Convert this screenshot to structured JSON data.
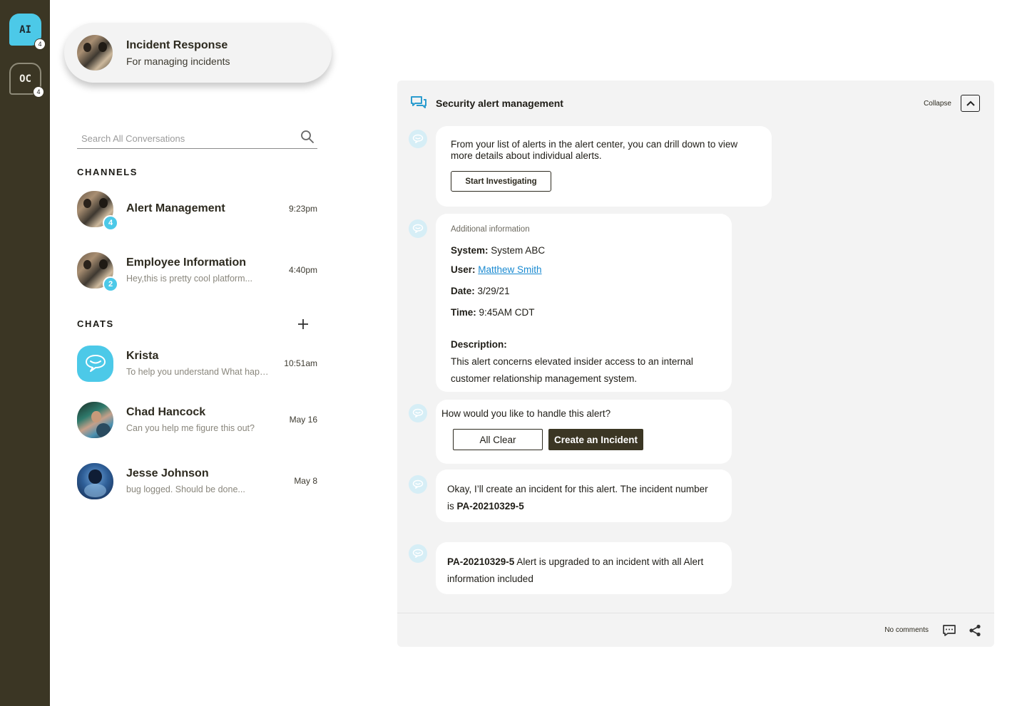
{
  "rail": {
    "workspaces": [
      {
        "label": "AI",
        "badge": "4"
      },
      {
        "label": "OC",
        "badge": "4"
      }
    ]
  },
  "team": {
    "name": "Incident Response",
    "subtitle": "For managing incidents"
  },
  "search": {
    "placeholder": "Search All Conversations"
  },
  "channels": {
    "title": "CHANNELS",
    "items": [
      {
        "name": "Alert Management",
        "preview": "",
        "time": "9:23pm",
        "badge": "4"
      },
      {
        "name": "Employee Information",
        "preview": "Hey,this is pretty cool platform...",
        "time": "4:40pm",
        "badge": "2"
      }
    ]
  },
  "chats": {
    "title": "CHATS",
    "items": [
      {
        "name": "Krista",
        "preview": "To help you understand What happe..",
        "time": "10:51am"
      },
      {
        "name": "Chad Hancock",
        "preview": "Can you help me figure this out?",
        "time": "May 16"
      },
      {
        "name": "Jesse Johnson",
        "preview": "bug logged. Should be done...",
        "time": "May 8"
      }
    ]
  },
  "panel": {
    "title": "Security alert management",
    "collapse_label": "Collapse",
    "messages": {
      "intro": "From your list of alerts in the alert center, you can drill down to view more details about individual alerts.",
      "start_button": "Start Investigating",
      "info_title": "Additional information",
      "system_label": "System:",
      "system_value": "System ABC",
      "user_label": "User:",
      "user_value": "Matthew Smith",
      "date_label": "Date:",
      "date_value": "3/29/21",
      "time_label": "Time:",
      "time_value": "9:45AM CDT",
      "description_label": "Description:",
      "description_value": "This alert concerns elevated insider access to an internal customer relationship management system.",
      "question": "How would you like to handle this alert?",
      "all_clear_button": "All Clear",
      "create_incident_button": "Create an Incident",
      "confirm_prefix": "Okay, I’ll create an incident for this alert. The incident number is ",
      "incident_number": "PA-20210329-5",
      "upgrade_id": "PA-20210329-5",
      "upgrade_text": " Alert is upgraded to an incident with all Alert information included"
    },
    "footer": {
      "comments_label": "No comments"
    }
  },
  "colors": {
    "rail": "#3b3624",
    "accent": "#4cc9e8",
    "dark_button": "#3b3624",
    "link": "#1a8ad1"
  },
  "icons": [
    "search-icon",
    "plus-icon",
    "chat-bubbles-icon",
    "chevron-up-icon",
    "bot-icon",
    "comment-icon",
    "share-icon"
  ]
}
